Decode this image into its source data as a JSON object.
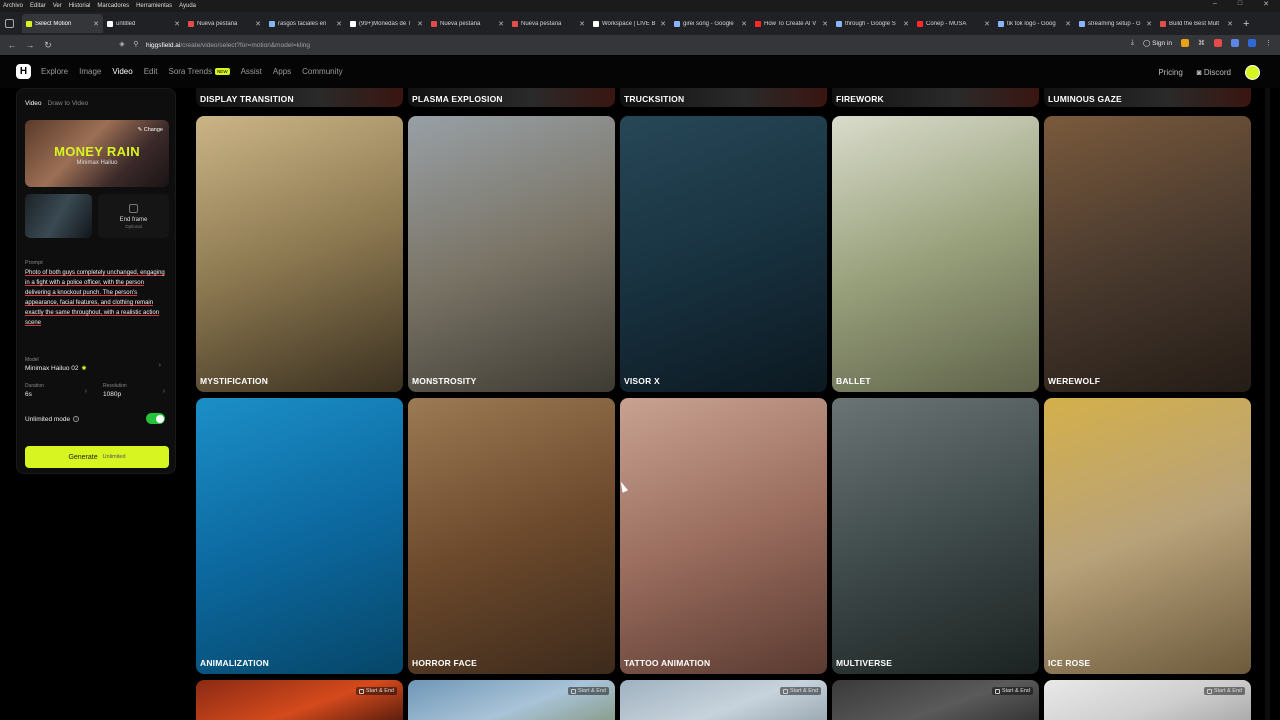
{
  "os_menu": [
    "Archivo",
    "Editar",
    "Ver",
    "Historial",
    "Marcadores",
    "Herramientas",
    "Ayuda"
  ],
  "tabs": [
    {
      "title": "Select Motion",
      "active": true,
      "favicon_color": "#d7f520"
    },
    {
      "title": "untitled",
      "active": false,
      "favicon_color": "#ffffff"
    },
    {
      "title": "Nueva pestaña",
      "active": false,
      "favicon_color": "#e44c4c"
    },
    {
      "title": "rasgos faciales en",
      "active": false,
      "favicon_color": "#8ab4f8"
    },
    {
      "title": "(99+)Monedas de T",
      "active": false,
      "favicon_color": "#ffffff"
    },
    {
      "title": "Nueva pestaña",
      "active": false,
      "favicon_color": "#e44c4c"
    },
    {
      "title": "Nueva pestaña",
      "active": false,
      "favicon_color": "#e44c4c"
    },
    {
      "title": "Workspace | LIVE B",
      "active": false,
      "favicon_color": "#ffffff"
    },
    {
      "title": "girei song - Google",
      "active": false,
      "favicon_color": "#8ab4f8"
    },
    {
      "title": "How To Create AI V",
      "active": false,
      "favicon_color": "#ff2b2b"
    },
    {
      "title": "through - Google S",
      "active": false,
      "favicon_color": "#8ab4f8"
    },
    {
      "title": "Conep - MUSA",
      "active": false,
      "favicon_color": "#ff2b2b"
    },
    {
      "title": "tik tok logo - Goog",
      "active": false,
      "favicon_color": "#8ab4f8"
    },
    {
      "title": "streaming setup - G",
      "active": false,
      "favicon_color": "#8ab4f8"
    },
    {
      "title": "Build the Best Mult",
      "active": false,
      "favicon_color": "#e44c4c"
    }
  ],
  "address": {
    "host": "higgsfield.ai",
    "path": "/create/video/select?for=motion&model=kling",
    "signin": "Sign in"
  },
  "app_nav": {
    "logo": "H",
    "items": [
      {
        "label": "Explore",
        "active": false
      },
      {
        "label": "Image",
        "active": false
      },
      {
        "label": "Video",
        "active": true
      },
      {
        "label": "Edit",
        "active": false
      },
      {
        "label": "Sora Trends",
        "active": false,
        "badge": "NEW"
      },
      {
        "label": "Assist",
        "active": false
      },
      {
        "label": "Apps",
        "active": false
      },
      {
        "label": "Community",
        "active": false
      }
    ],
    "pricing": "Pricing",
    "discord": "Discord"
  },
  "sidebar": {
    "tab_video": "Video",
    "tab_draw": "Draw to Video",
    "motion_title": "MONEY RAIN",
    "motion_model": "Minimax Hailuo",
    "change_label": "Change",
    "end_frame_label": "End frame",
    "end_frame_optional": "Optional",
    "prompt_label": "Prompt",
    "prompt_text": "Photo of both guys completely unchanged, engaging in a fight with a police officer, with the person delivering a knockout punch. The person's appearance, facial features, and clothing remain exactly the same throughout, with a realistic action scene",
    "model_label": "Model",
    "model_value": "Minimax Hailuo 02",
    "duration_label": "Duration",
    "duration_value": "6s",
    "resolution_label": "Resolution",
    "resolution_value": "1080p",
    "unlimited_label": "Unlimited mode",
    "unlimited_on": true,
    "generate_label": "Generate",
    "generate_sub": "Unlimited"
  },
  "top_strip": [
    "DISPLAY TRANSITION",
    "PLASMA EXPLOSION",
    "TRUCKSITION",
    "FIREWORK",
    "LUMINOUS GAZE"
  ],
  "row1": [
    {
      "label": "MYSTIFICATION",
      "colors": [
        "#cbb587",
        "#8c7850",
        "#3a3020"
      ]
    },
    {
      "label": "MONSTROSITY",
      "colors": [
        "#98a0a6",
        "#7a7466",
        "#3e3b33"
      ]
    },
    {
      "label": "VISOR X",
      "colors": [
        "#274757",
        "#183240",
        "#0b1820"
      ]
    },
    {
      "label": "BALLET",
      "colors": [
        "#d9dccb",
        "#98a07b",
        "#5f634a"
      ]
    },
    {
      "label": "WEREWOLF",
      "colors": [
        "#7a5a3c",
        "#4a3a2e",
        "#241c16"
      ]
    }
  ],
  "row2": [
    {
      "label": "ANIMALIZATION",
      "colors": [
        "#1c8fc7",
        "#0c69a0",
        "#064668"
      ]
    },
    {
      "label": "HORROR FACE",
      "colors": [
        "#9c7a54",
        "#6d4a2c",
        "#3d2a1b"
      ]
    },
    {
      "label": "TATTOO ANIMATION",
      "colors": [
        "#c9a292",
        "#9a6d5e",
        "#5a3a30"
      ]
    },
    {
      "label": "MULTIVERSE",
      "colors": [
        "#6b7474",
        "#3f4a4a",
        "#1c2222"
      ]
    },
    {
      "label": "ICE ROSE",
      "colors": [
        "#d4b04a",
        "#b8a27a",
        "#6c5a3c"
      ]
    }
  ],
  "row3": [
    {
      "tag": "Start & End",
      "colors": [
        "#8a2a14",
        "#d44a1c",
        "#2a0c08"
      ]
    },
    {
      "tag": "Start & End",
      "colors": [
        "#6e97b6",
        "#a9c3d8",
        "#7c8f6e"
      ]
    },
    {
      "tag": "Start & End",
      "colors": [
        "#9fb2c0",
        "#c7d3dc",
        "#8a99a4"
      ]
    },
    {
      "tag": "Start & End",
      "colors": [
        "#3a3a3a",
        "#5a5a5a",
        "#262626"
      ]
    },
    {
      "tag": "Start & End",
      "colors": [
        "#e9e9e9",
        "#cfcfcf",
        "#9c9c9c"
      ]
    }
  ],
  "accent": "#d7f520"
}
